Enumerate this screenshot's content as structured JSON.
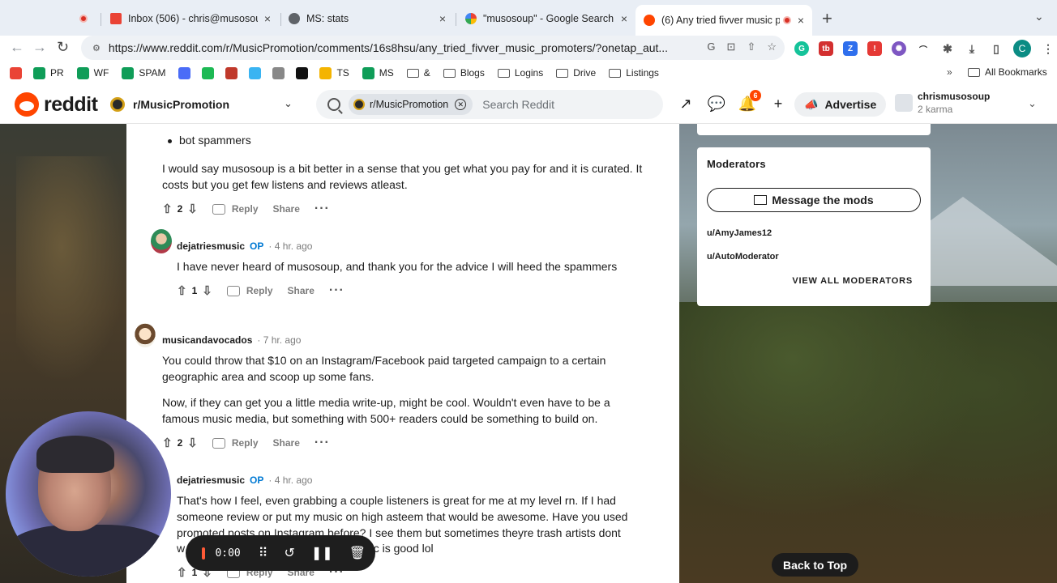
{
  "browser": {
    "tabs": [
      {
        "title": "",
        "recording": true
      },
      {
        "title": "Inbox (506) - chris@musosoup",
        "close": "×"
      },
      {
        "title": "MS: stats",
        "close": "×"
      },
      {
        "title": "\"musosoup\" - Google Search",
        "close": "×"
      },
      {
        "title": "(6) Any tried fivver music p",
        "close": "×",
        "active": true
      }
    ],
    "new_tab": "+",
    "url": "https://www.reddit.com/r/MusicPromotion/comments/16s8hsu/any_tried_fivver_music_promoters/?onetap_aut...",
    "profile_letter": "C",
    "bookmarks": [
      {
        "label": "",
        "icon": "gmail-icon",
        "color": "#ea4335"
      },
      {
        "label": "PR",
        "icon": "sheets-icon",
        "color": "#0f9d58"
      },
      {
        "label": "WF",
        "icon": "sheets-icon",
        "color": "#0f9d58"
      },
      {
        "label": "SPAM",
        "icon": "sheets-icon",
        "color": "#0f9d58"
      },
      {
        "label": "",
        "icon": "slides-icon",
        "color": "#4a6cf7"
      },
      {
        "label": "",
        "icon": "s-icon",
        "color": "#1db954"
      },
      {
        "label": "",
        "icon": "flag-icon",
        "color": "#c0392b"
      },
      {
        "label": "",
        "icon": "c-icon",
        "color": "#3ab4f2"
      },
      {
        "label": "",
        "icon": "globe-icon",
        "color": "#888888"
      },
      {
        "label": "",
        "icon": "w-icon",
        "color": "#111111"
      },
      {
        "label": "TS",
        "icon": "drive-icon",
        "color": "#f4b400"
      },
      {
        "label": "MS",
        "icon": "sheets-icon",
        "color": "#0f9d58"
      },
      {
        "label": "&",
        "icon": "folder-icon",
        "color": ""
      },
      {
        "label": "Blogs",
        "icon": "folder-icon",
        "color": ""
      },
      {
        "label": "Logins",
        "icon": "folder-icon",
        "color": ""
      },
      {
        "label": "Drive",
        "icon": "folder-icon",
        "color": ""
      },
      {
        "label": "Listings",
        "icon": "folder-icon",
        "color": ""
      }
    ],
    "bookmarks_more": "»",
    "all_bookmarks": "All Bookmarks"
  },
  "reddit": {
    "logo": "reddit",
    "community": "r/MusicPromotion",
    "search_chip": "r/MusicPromotion",
    "search_placeholder": "Search Reddit",
    "notifications": "6",
    "advertise": "Advertise",
    "username": "chrismusosoup",
    "karma": "2 karma"
  },
  "comments": {
    "c1": {
      "bullet": "bot spammers",
      "text": "I would say musosoup is a bit better in a sense that you get what you pay for and it is curated. It costs but you get few listens and reviews atleast.",
      "votes": "2"
    },
    "c2": {
      "author": "dejatriesmusic",
      "op": "OP",
      "time": "· 4 hr. ago",
      "text": "I have never heard of musosoup, and thank you for the advice I will heed the spammers",
      "votes": "1"
    },
    "c3": {
      "author": "musicandavocados",
      "time": "· 7 hr. ago",
      "p1": "You could throw that $10 on an Instagram/Facebook paid targeted campaign to a certain geographic area and scoop up some fans.",
      "p2": "Now, if they can get you a little media write-up, might be cool. Wouldn't even have to be a famous music media, but something with 500+ readers could be something to build on.",
      "votes": "2"
    },
    "c4": {
      "author": "dejatriesmusic",
      "op": "OP",
      "time": "· 4 hr. ago",
      "text": "That's how I feel, even grabbing a couple listeners is great for me at my level rn. If I had someone review or put my music on high asteem that would be awesome. Have you used promoted posts on Instagram before? I see them but sometimes theyre trash artists dont",
      "text_end": "w                               gh i think my music is good lol",
      "votes": "1"
    },
    "reply": "Reply",
    "share": "Share"
  },
  "sidebar": {
    "moderators_title": "Moderators",
    "message_mods": "Message the mods",
    "mods": [
      "u/AmyJames12",
      "u/AutoModerator"
    ],
    "view_all": "VIEW ALL MODERATORS"
  },
  "back_to_top": "Back to Top",
  "recorder": {
    "time": "0:00"
  }
}
